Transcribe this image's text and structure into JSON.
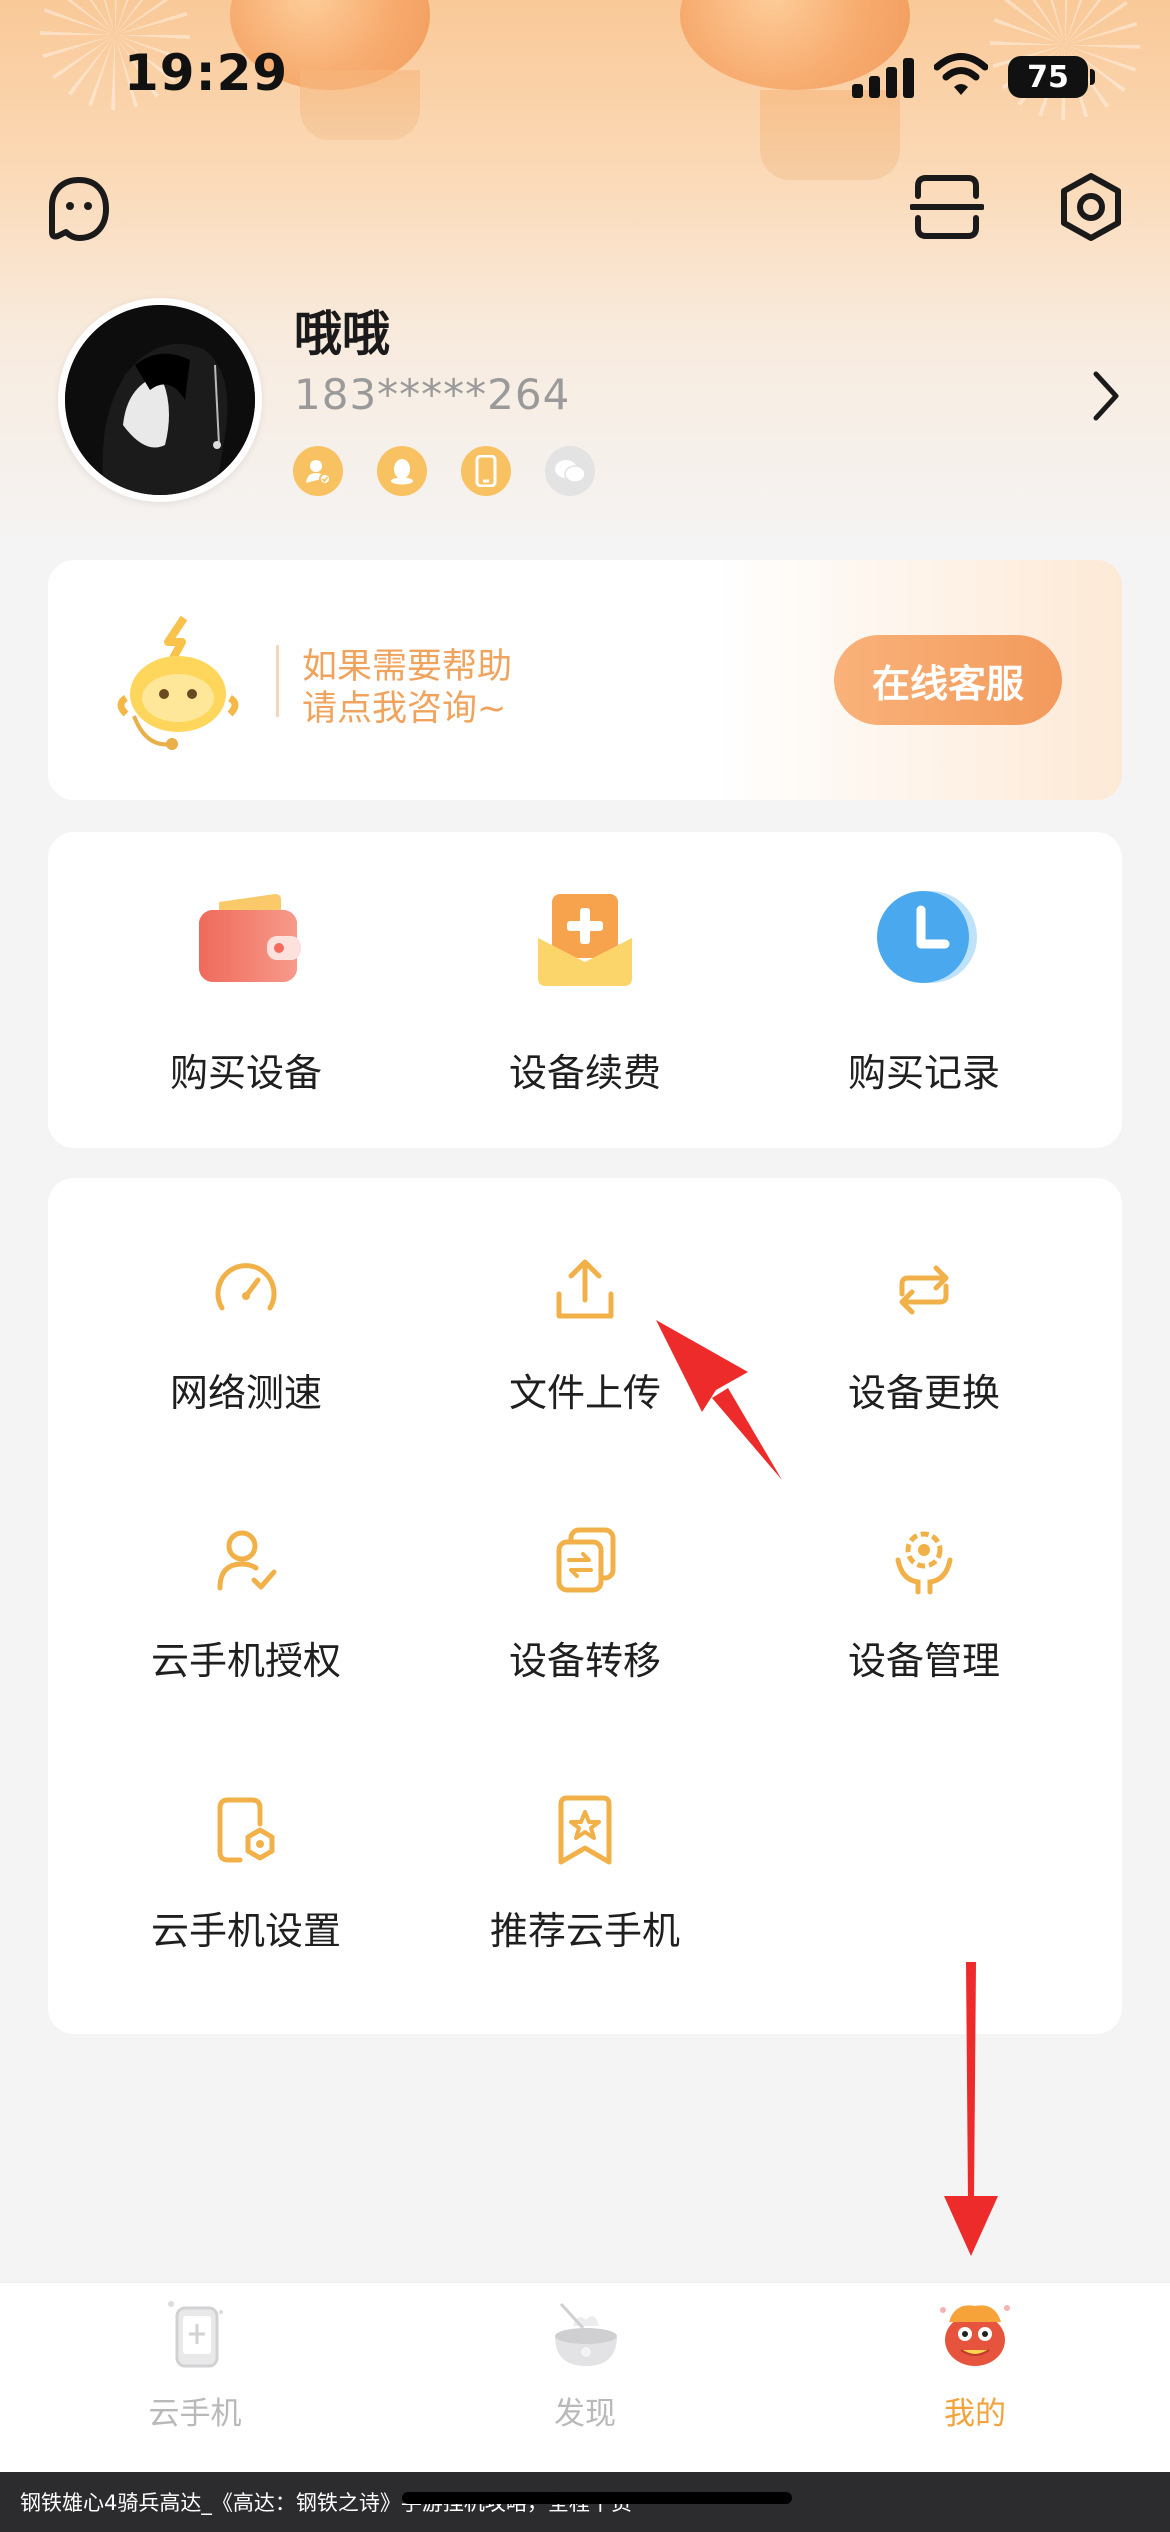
{
  "status_bar": {
    "time": "19:29",
    "battery": "75"
  },
  "profile": {
    "nickname": "哦哦",
    "phone": "183*****264",
    "bind_icons": [
      "user-verified-icon",
      "qq-icon",
      "phone-icon",
      "wechat-icon"
    ]
  },
  "service": {
    "line1": "如果需要帮助",
    "line2": "请点我咨询~",
    "button": "在线客服"
  },
  "quick_actions": [
    {
      "label": "购买设备",
      "icon": "wallet-icon"
    },
    {
      "label": "设备续费",
      "icon": "renew-envelope-icon"
    },
    {
      "label": "购买记录",
      "icon": "clock-icon"
    }
  ],
  "tools": [
    {
      "label": "网络测速",
      "icon": "speedometer-icon"
    },
    {
      "label": "文件上传",
      "icon": "upload-icon"
    },
    {
      "label": "设备更换",
      "icon": "swap-icon"
    },
    {
      "label": "云手机授权",
      "icon": "user-check-icon"
    },
    {
      "label": "设备转移",
      "icon": "transfer-icon"
    },
    {
      "label": "设备管理",
      "icon": "gear-manage-icon"
    },
    {
      "label": "云手机设置",
      "icon": "phone-settings-icon"
    },
    {
      "label": "推荐云手机",
      "icon": "bookmark-star-icon"
    }
  ],
  "tabbar": [
    {
      "label": "云手机",
      "icon": "cloud-phone-icon",
      "active": false
    },
    {
      "label": "发现",
      "icon": "discover-bowl-icon",
      "active": false
    },
    {
      "label": "我的",
      "icon": "lion-dance-icon",
      "active": true
    }
  ],
  "colors": {
    "accent": "#f3a33c",
    "icon_stroke": "#f2b048",
    "service_text": "#f0a35c"
  },
  "caption": "钢铁雄心4骑兵高达_《高达：钢铁之诗》手游挂机攻略，全程干货"
}
